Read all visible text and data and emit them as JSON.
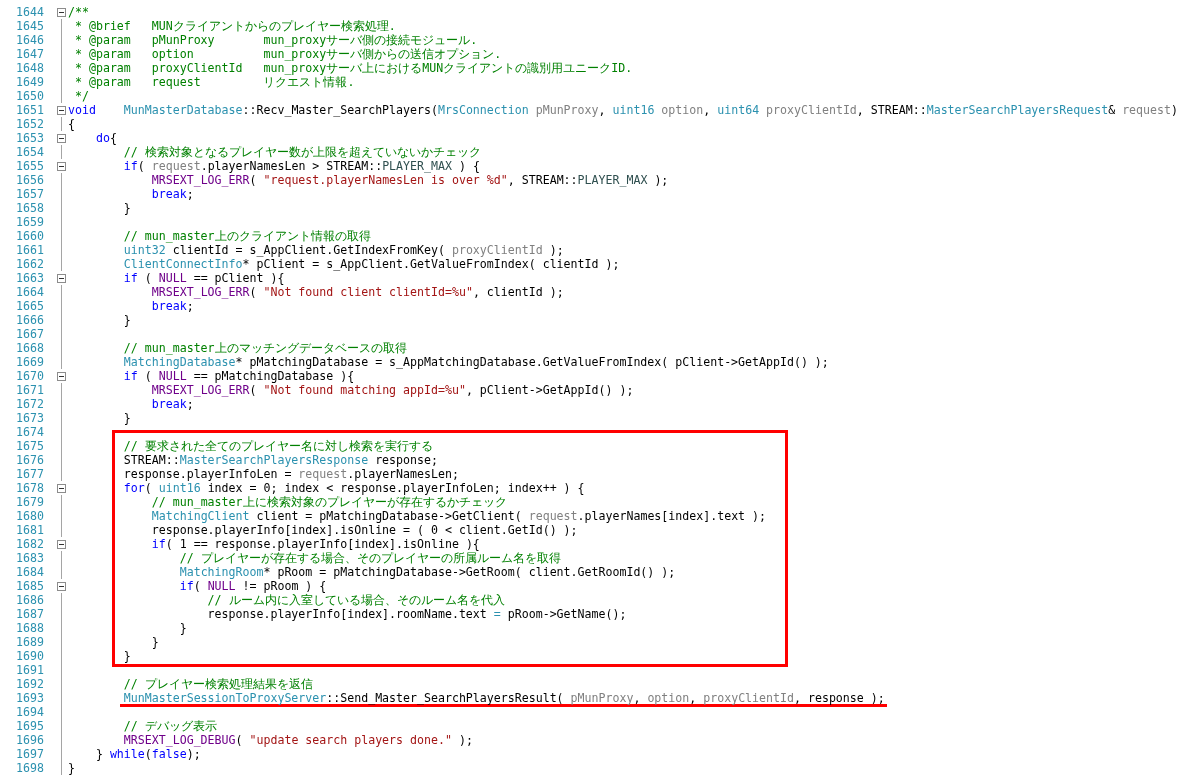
{
  "lines": [
    {
      "kind": "line",
      "number": "1644",
      "foldable": true,
      "tokens": [
        {
          "kind": "comment",
          "text": "/**"
        }
      ]
    },
    {
      "kind": "line",
      "number": "1645",
      "foldable": false,
      "tokens": [
        {
          "kind": "comment",
          "text": " * @brief   MUNクライアントからのプレイヤー検索処理."
        }
      ]
    },
    {
      "kind": "line",
      "number": "1646",
      "foldable": false,
      "tokens": [
        {
          "kind": "comment",
          "text": " * @param   pMunProxy       mun_proxyサーバ側の接続モジュール."
        }
      ]
    },
    {
      "kind": "line",
      "number": "1647",
      "foldable": false,
      "tokens": [
        {
          "kind": "comment",
          "text": " * @param   option          mun_proxyサーバ側からの送信オプション."
        }
      ]
    },
    {
      "kind": "line",
      "number": "1648",
      "foldable": false,
      "tokens": [
        {
          "kind": "comment",
          "text": " * @param   proxyClientId   mun_proxyサーバ上におけるMUNクライアントの識別用ユニークID."
        }
      ]
    },
    {
      "kind": "line",
      "number": "1649",
      "foldable": false,
      "tokens": [
        {
          "kind": "comment",
          "text": " * @param   request         リクエスト情報."
        }
      ]
    },
    {
      "kind": "line",
      "number": "1650",
      "foldable": false,
      "tokens": [
        {
          "kind": "comment",
          "text": " */"
        }
      ]
    },
    {
      "kind": "line",
      "number": "1651",
      "foldable": true,
      "tokens": [
        {
          "kind": "keyword",
          "text": "void"
        },
        {
          "kind": "type",
          "text": "    MunMasterDatabase"
        },
        {
          "kind": "plain",
          "text": "::Recv_Master_SearchPlayers("
        },
        {
          "kind": "type",
          "text": "MrsConnection"
        },
        {
          "kind": "param",
          "text": " pMunProxy"
        },
        {
          "kind": "plain",
          "text": ", "
        },
        {
          "kind": "type",
          "text": "uint16"
        },
        {
          "kind": "param",
          "text": " option"
        },
        {
          "kind": "plain",
          "text": ", "
        },
        {
          "kind": "type",
          "text": "uint64"
        },
        {
          "kind": "param",
          "text": " proxyClientId"
        },
        {
          "kind": "plain",
          "text": ", STREAM::"
        },
        {
          "kind": "type",
          "text": "MasterSearchPlayersRequest"
        },
        {
          "kind": "plain",
          "text": "& "
        },
        {
          "kind": "param",
          "text": "request"
        },
        {
          "kind": "plain",
          "text": ")"
        }
      ]
    },
    {
      "kind": "line",
      "number": "1652",
      "foldable": false,
      "tokens": [
        {
          "kind": "plain",
          "text": "{"
        }
      ]
    },
    {
      "kind": "line",
      "number": "1653",
      "foldable": true,
      "tokens": [
        {
          "kind": "keyword",
          "text": "    do"
        },
        {
          "kind": "plain",
          "text": "{"
        }
      ]
    },
    {
      "kind": "line",
      "number": "1654",
      "foldable": false,
      "tokens": [
        {
          "kind": "comment",
          "text": "        // 検索対象となるプレイヤー数が上限を超えていないかチェック"
        }
      ]
    },
    {
      "kind": "line",
      "number": "1655",
      "foldable": true,
      "tokens": [
        {
          "kind": "keyword",
          "text": "        if"
        },
        {
          "kind": "plain",
          "text": "( "
        },
        {
          "kind": "param",
          "text": "request"
        },
        {
          "kind": "plain",
          "text": ".playerNamesLen > STREAM::"
        },
        {
          "kind": "constant",
          "text": "PLAYER_MAX"
        },
        {
          "kind": "plain",
          "text": " ) {"
        }
      ]
    },
    {
      "kind": "line",
      "number": "1656",
      "foldable": false,
      "tokens": [
        {
          "kind": "macro",
          "text": "            MRSEXT_LOG_ERR"
        },
        {
          "kind": "plain",
          "text": "( "
        },
        {
          "kind": "string",
          "text": "\"request.playerNamesLen is over %d\""
        },
        {
          "kind": "plain",
          "text": ", STREAM::"
        },
        {
          "kind": "constant",
          "text": "PLAYER_MAX"
        },
        {
          "kind": "plain",
          "text": " );"
        }
      ]
    },
    {
      "kind": "line",
      "number": "1657",
      "foldable": false,
      "tokens": [
        {
          "kind": "keyword",
          "text": "            break"
        },
        {
          "kind": "plain",
          "text": ";"
        }
      ]
    },
    {
      "kind": "line",
      "number": "1658",
      "foldable": false,
      "tokens": [
        {
          "kind": "plain",
          "text": "        }"
        }
      ]
    },
    {
      "kind": "line",
      "number": "1659",
      "foldable": false
    },
    {
      "kind": "line",
      "number": "1660",
      "foldable": false,
      "tokens": [
        {
          "kind": "comment",
          "text": "        // mun_master上のクライアント情報の取得"
        }
      ]
    },
    {
      "kind": "line",
      "number": "1661",
      "foldable": false,
      "tokens": [
        {
          "kind": "type",
          "text": "        uint32"
        },
        {
          "kind": "plain",
          "text": " clientId = s_AppClient.GetIndexFromKey( "
        },
        {
          "kind": "param",
          "text": "proxyClientId"
        },
        {
          "kind": "plain",
          "text": " );"
        }
      ]
    },
    {
      "kind": "line",
      "number": "1662",
      "foldable": false,
      "tokens": [
        {
          "kind": "type",
          "text": "        ClientConnectInfo"
        },
        {
          "kind": "plain",
          "text": "* pClient = s_AppClient.GetValueFromIndex( clientId );"
        }
      ]
    },
    {
      "kind": "line",
      "number": "1663",
      "foldable": true,
      "tokens": [
        {
          "kind": "keyword",
          "text": "        if"
        },
        {
          "kind": "plain",
          "text": " ( "
        },
        {
          "kind": "macro",
          "text": "NULL"
        },
        {
          "kind": "plain",
          "text": " == pClient ){"
        }
      ]
    },
    {
      "kind": "line",
      "number": "1664",
      "foldable": false,
      "tokens": [
        {
          "kind": "macro",
          "text": "            MRSEXT_LOG_ERR"
        },
        {
          "kind": "plain",
          "text": "( "
        },
        {
          "kind": "string",
          "text": "\"Not found client clientId=%u\""
        },
        {
          "kind": "plain",
          "text": ", clientId );"
        }
      ]
    },
    {
      "kind": "line",
      "number": "1665",
      "foldable": false,
      "tokens": [
        {
          "kind": "keyword",
          "text": "            break"
        },
        {
          "kind": "plain",
          "text": ";"
        }
      ]
    },
    {
      "kind": "line",
      "number": "1666",
      "foldable": false,
      "tokens": [
        {
          "kind": "plain",
          "text": "        }"
        }
      ]
    },
    {
      "kind": "line",
      "number": "1667",
      "foldable": false
    },
    {
      "kind": "line",
      "number": "1668",
      "foldable": false,
      "tokens": [
        {
          "kind": "comment",
          "text": "        // mun_master上のマッチングデータベースの取得"
        }
      ]
    },
    {
      "kind": "line",
      "number": "1669",
      "foldable": false,
      "tokens": [
        {
          "kind": "type",
          "text": "        MatchingDatabase"
        },
        {
          "kind": "plain",
          "text": "* pMatchingDatabase = s_AppMatchingDatabase.GetValueFromIndex( pClient->GetAppId() );"
        }
      ]
    },
    {
      "kind": "line",
      "number": "1670",
      "foldable": true,
      "tokens": [
        {
          "kind": "keyword",
          "text": "        if"
        },
        {
          "kind": "plain",
          "text": " ( "
        },
        {
          "kind": "macro",
          "text": "NULL"
        },
        {
          "kind": "plain",
          "text": " == pMatchingDatabase ){"
        }
      ]
    },
    {
      "kind": "line",
      "number": "1671",
      "foldable": false,
      "tokens": [
        {
          "kind": "macro",
          "text": "            MRSEXT_LOG_ERR"
        },
        {
          "kind": "plain",
          "text": "( "
        },
        {
          "kind": "string",
          "text": "\"Not found matching appId=%u\""
        },
        {
          "kind": "plain",
          "text": ", pClient->GetAppId() );"
        }
      ]
    },
    {
      "kind": "line",
      "number": "1672",
      "foldable": false,
      "tokens": [
        {
          "kind": "keyword",
          "text": "            break"
        },
        {
          "kind": "plain",
          "text": ";"
        }
      ]
    },
    {
      "kind": "line",
      "number": "1673",
      "foldable": false,
      "tokens": [
        {
          "kind": "plain",
          "text": "        }"
        }
      ]
    },
    {
      "kind": "line",
      "number": "1674",
      "foldable": false
    },
    {
      "kind": "highlight_box",
      "lines": [
        {
          "kind": "line",
          "number": "1675",
          "foldable": false,
          "tokens": [
            {
              "kind": "comment",
              "text": "        // 要求された全てのプレイヤー名に対し検索を実行する"
            }
          ]
        },
        {
          "kind": "line",
          "number": "1676",
          "foldable": false,
          "tokens": [
            {
              "kind": "plain",
              "text": "        STREAM::"
            },
            {
              "kind": "type",
              "text": "MasterSearchPlayersResponse"
            },
            {
              "kind": "plain",
              "text": " response;"
            }
          ]
        },
        {
          "kind": "line",
          "number": "1677",
          "foldable": false,
          "tokens": [
            {
              "kind": "plain",
              "text": "        response.playerInfoLen = "
            },
            {
              "kind": "param",
              "text": "request"
            },
            {
              "kind": "plain",
              "text": ".playerNamesLen;"
            }
          ]
        },
        {
          "kind": "line",
          "number": "1678",
          "foldable": true,
          "tokens": [
            {
              "kind": "keyword",
              "text": "        for"
            },
            {
              "kind": "plain",
              "text": "( "
            },
            {
              "kind": "type",
              "text": "uint16"
            },
            {
              "kind": "plain",
              "text": " index = 0; index < response.playerInfoLen; index++ ) {"
            }
          ]
        },
        {
          "kind": "line",
          "number": "1679",
          "foldable": false,
          "tokens": [
            {
              "kind": "comment",
              "text": "            // mun_master上に検索対象のプレイヤーが存在するかチェック"
            }
          ]
        },
        {
          "kind": "line",
          "number": "1680",
          "foldable": false,
          "tokens": [
            {
              "kind": "type",
              "text": "            MatchingClient"
            },
            {
              "kind": "plain",
              "text": " client = pMatchingDatabase->GetClient( "
            },
            {
              "kind": "param",
              "text": "request"
            },
            {
              "kind": "plain",
              "text": ".playerNames[index].text );"
            }
          ]
        },
        {
          "kind": "line",
          "number": "1681",
          "foldable": false,
          "tokens": [
            {
              "kind": "plain",
              "text": "            response.playerInfo[index].isOnline = ( 0 < client.GetId() );"
            }
          ]
        },
        {
          "kind": "line",
          "number": "1682",
          "foldable": true,
          "tokens": [
            {
              "kind": "keyword",
              "text": "            if"
            },
            {
              "kind": "plain",
              "text": "( 1 == response.playerInfo[index].isOnline ){"
            }
          ]
        },
        {
          "kind": "line",
          "number": "1683",
          "foldable": false,
          "tokens": [
            {
              "kind": "comment",
              "text": "                // プレイヤーが存在する場合、そのプレイヤーの所属ルーム名を取得"
            }
          ]
        },
        {
          "kind": "line",
          "number": "1684",
          "foldable": false,
          "tokens": [
            {
              "kind": "type",
              "text": "                MatchingRoom"
            },
            {
              "kind": "plain",
              "text": "* pRoom = pMatchingDatabase->GetRoom( client.GetRoomId() );"
            }
          ]
        },
        {
          "kind": "line",
          "number": "1685",
          "foldable": true,
          "tokens": [
            {
              "kind": "keyword",
              "text": "                if"
            },
            {
              "kind": "plain",
              "text": "( "
            },
            {
              "kind": "macro",
              "text": "NULL"
            },
            {
              "kind": "plain",
              "text": " != pRoom ) {"
            }
          ]
        },
        {
          "kind": "line",
          "number": "1686",
          "foldable": false,
          "tokens": [
            {
              "kind": "comment",
              "text": "                    // ルーム内に入室している場合、そのルーム名を代入"
            }
          ]
        },
        {
          "kind": "line",
          "number": "1687",
          "foldable": false,
          "tokens": [
            {
              "kind": "plain",
              "text": "                    response.playerInfo[index].roomName.text "
            },
            {
              "kind": "type",
              "text": "="
            },
            {
              "kind": "plain",
              "text": " pRoom->GetName();"
            }
          ]
        },
        {
          "kind": "line",
          "number": "1688",
          "foldable": false,
          "tokens": [
            {
              "kind": "plain",
              "text": "                }"
            }
          ]
        },
        {
          "kind": "line",
          "number": "1689",
          "foldable": false,
          "tokens": [
            {
              "kind": "plain",
              "text": "            }"
            }
          ]
        },
        {
          "kind": "line",
          "number": "1690",
          "foldable": false,
          "tokens": [
            {
              "kind": "plain",
              "text": "        }"
            }
          ]
        }
      ]
    },
    {
      "kind": "line",
      "number": "1691",
      "foldable": false
    },
    {
      "kind": "line",
      "number": "1692",
      "foldable": false,
      "tokens": [
        {
          "kind": "comment",
          "text": "        // プレイヤー検索処理結果を返信"
        }
      ]
    },
    {
      "kind": "line",
      "number": "1693",
      "foldable": false,
      "underlined": true,
      "tokens": [
        {
          "kind": "type",
          "text": "        MunMasterSessionToProxyServer"
        },
        {
          "kind": "plain",
          "text": "::Send_Master_SearchPlayersResult( "
        },
        {
          "kind": "param",
          "text": "pMunProxy"
        },
        {
          "kind": "plain",
          "text": ", "
        },
        {
          "kind": "param",
          "text": "option"
        },
        {
          "kind": "plain",
          "text": ", "
        },
        {
          "kind": "param",
          "text": "proxyClientId"
        },
        {
          "kind": "plain",
          "text": ", response );"
        }
      ]
    },
    {
      "kind": "line",
      "number": "1694",
      "foldable": false
    },
    {
      "kind": "line",
      "number": "1695",
      "foldable": false,
      "tokens": [
        {
          "kind": "comment",
          "text": "        // デバッグ表示"
        }
      ]
    },
    {
      "kind": "line",
      "number": "1696",
      "foldable": false,
      "tokens": [
        {
          "kind": "macro",
          "text": "        MRSEXT_LOG_DEBUG"
        },
        {
          "kind": "plain",
          "text": "( "
        },
        {
          "kind": "string",
          "text": "\"update search players done.\""
        },
        {
          "kind": "plain",
          "text": " );"
        }
      ]
    },
    {
      "kind": "line",
      "number": "1697",
      "foldable": false,
      "tokens": [
        {
          "kind": "plain",
          "text": "    } "
        },
        {
          "kind": "keyword",
          "text": "while"
        },
        {
          "kind": "plain",
          "text": "("
        },
        {
          "kind": "keyword",
          "text": "false"
        },
        {
          "kind": "plain",
          "text": ");"
        }
      ]
    },
    {
      "kind": "line",
      "number": "1698",
      "foldable": false,
      "tokens": [
        {
          "kind": "plain",
          "text": "}"
        }
      ]
    }
  ]
}
